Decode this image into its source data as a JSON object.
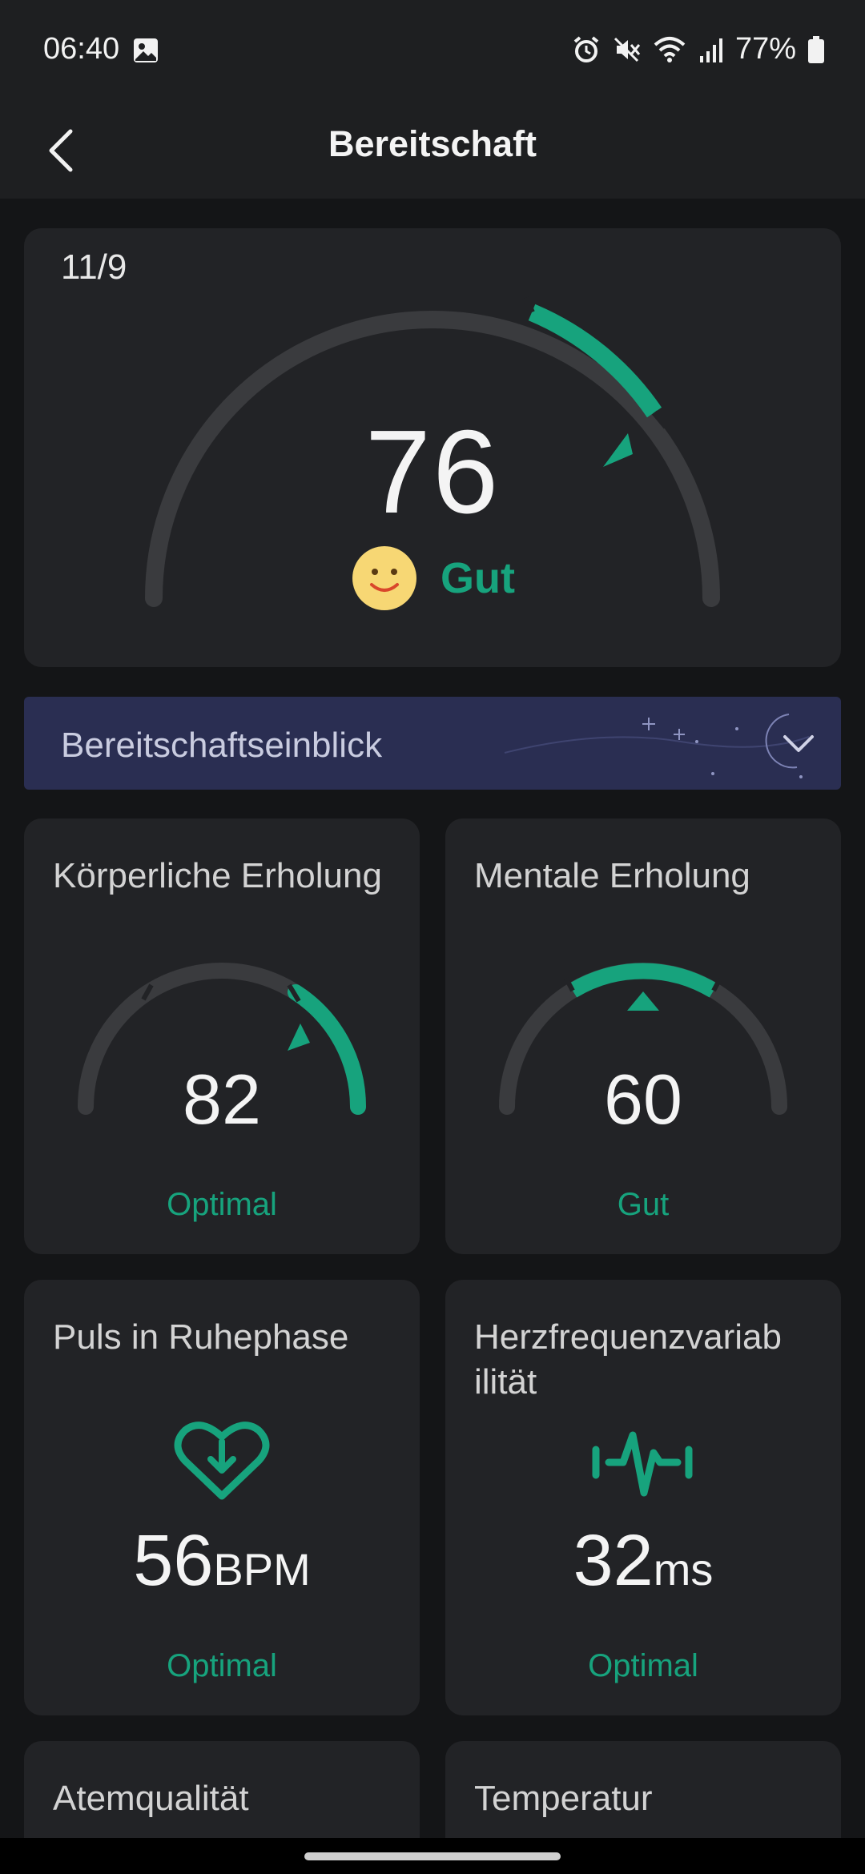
{
  "status_bar": {
    "time": "06:40",
    "battery": "77%",
    "icons": [
      "image-icon",
      "alarm-icon",
      "mute-icon",
      "wifi-icon",
      "signal-icon",
      "battery-icon"
    ]
  },
  "app_bar": {
    "title": "Bereitschaft",
    "back_icon": "chevron-left-icon"
  },
  "readiness": {
    "date": "11/9",
    "score": "76",
    "status": "Gut",
    "status_icon": "smiley-icon"
  },
  "insight": {
    "label": "Bereitschaftseinblick",
    "expand_icon": "chevron-down-icon"
  },
  "tiles": {
    "physical": {
      "title": "Körperliche Erholung",
      "value": "82",
      "status": "Optimal"
    },
    "mental": {
      "title": "Mentale Erholung",
      "value": "60",
      "status": "Gut"
    },
    "resting_hr": {
      "title": "Puls in Ruhephase",
      "value": "56",
      "unit": "BPM",
      "status": "Optimal",
      "icon": "heart-down-icon"
    },
    "hrv": {
      "title": "Herzfrequenzvariab ilität",
      "value": "32",
      "unit": "ms",
      "status": "Optimal",
      "icon": "heartbeat-icon"
    },
    "breath": {
      "title": "Atemqualität"
    },
    "temperature": {
      "title": "Temperatur"
    }
  },
  "colors": {
    "accent": "#17a37d",
    "card": "#222326",
    "background": "#141517",
    "track": "#3a3b3e",
    "insight_bg": "#2a2e52"
  }
}
